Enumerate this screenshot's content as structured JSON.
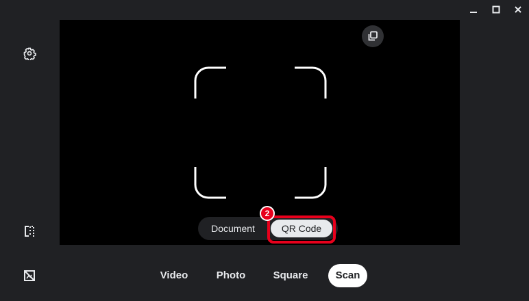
{
  "window_controls": {
    "minimize_icon": "minimize-icon",
    "maximize_icon": "maximize-icon",
    "close_icon": "close-icon"
  },
  "left_toolbar": {
    "settings_icon": "gear-icon",
    "mirror_icon": "mirror-flip-icon",
    "gallery_icon": "gallery-icon"
  },
  "preview": {
    "copy_icon": "copy-icon",
    "frame": "scan-frame-corners"
  },
  "scan_type": {
    "options": [
      "Document",
      "QR Code"
    ],
    "selected": "QR Code"
  },
  "annotation": {
    "step_number": "2",
    "highlight_color": "#e8001c"
  },
  "modes": {
    "items": [
      "Video",
      "Photo",
      "Square",
      "Scan"
    ],
    "selected": "Scan"
  },
  "colors": {
    "background": "#202124",
    "preview": "#000000",
    "text": "#e8eaed",
    "selected_pill": "#ffffff"
  }
}
